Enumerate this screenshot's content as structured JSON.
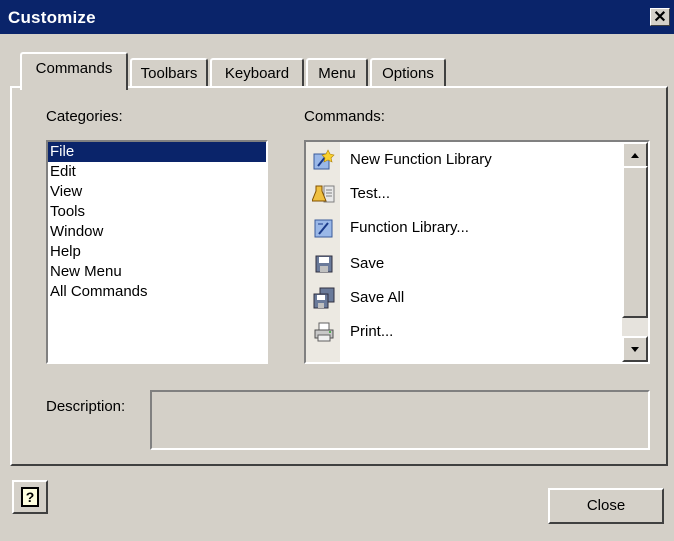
{
  "window": {
    "title": "Customize",
    "close_glyph": "✕"
  },
  "tabs": [
    {
      "label": "Commands",
      "active": true
    },
    {
      "label": "Toolbars",
      "active": false
    },
    {
      "label": "Keyboard",
      "active": false
    },
    {
      "label": "Menu",
      "active": false
    },
    {
      "label": "Options",
      "active": false
    }
  ],
  "categories": {
    "label": "Categories:",
    "items": [
      "File",
      "Edit",
      "View",
      "Tools",
      "Window",
      "Help",
      "New Menu",
      "All Commands"
    ],
    "selected": "File"
  },
  "commands": {
    "label": "Commands:",
    "items": [
      {
        "label": "New Function Library",
        "icon": "new-function-library-icon"
      },
      {
        "label": "Test...",
        "icon": "test-icon"
      },
      {
        "label": "Function Library...",
        "icon": "function-library-icon"
      },
      {
        "label": "Save",
        "icon": "save-icon"
      },
      {
        "label": "Save All",
        "icon": "save-all-icon"
      },
      {
        "label": "Print...",
        "icon": "print-icon"
      }
    ]
  },
  "description": {
    "label": "Description:",
    "value": ""
  },
  "footer": {
    "help_glyph": "?",
    "close_label": "Close"
  }
}
